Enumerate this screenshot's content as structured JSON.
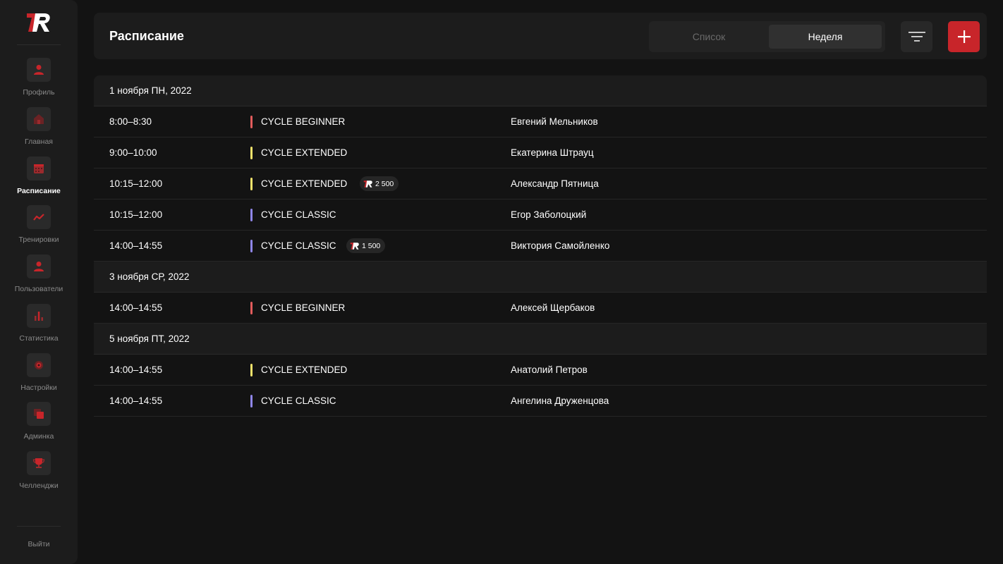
{
  "sidebar": {
    "items": [
      {
        "label": "Профиль",
        "icon": "user-icon"
      },
      {
        "label": "Главная",
        "icon": "home-icon"
      },
      {
        "label": "Расписание",
        "icon": "calendar-icon",
        "active": true
      },
      {
        "label": "Тренировки",
        "icon": "chart-line-icon"
      },
      {
        "label": "Пользователи",
        "icon": "users-icon"
      },
      {
        "label": "Статистика",
        "icon": "bar-chart-icon"
      },
      {
        "label": "Настройки",
        "icon": "gear-icon"
      },
      {
        "label": "Админка",
        "icon": "admin-icon"
      },
      {
        "label": "Челленджи",
        "icon": "trophy-icon"
      }
    ],
    "logout": "Выйти"
  },
  "header": {
    "title": "Расписание",
    "view_list": "Список",
    "view_week": "Неделя"
  },
  "schedule": {
    "days": [
      {
        "date": "1 ноября ПН, 2022",
        "rows": [
          {
            "time": "8:00–8:30",
            "name": "CYCLE BEGINNER",
            "color": "#e25c5c",
            "trainer": "Евгений Мельников",
            "badge": ""
          },
          {
            "time": "9:00–10:00",
            "name": "CYCLE EXTENDED",
            "color": "#f3e26b",
            "trainer": "Екатерина Штрауц",
            "badge": ""
          },
          {
            "time": "10:15–12:00",
            "name": "CYCLE EXTENDED",
            "color": "#f3e26b",
            "trainer": "Александр Пятница",
            "badge": "2 500"
          },
          {
            "time": "10:15–12:00",
            "name": "CYCLE CLASSIC",
            "color": "#8f86e8",
            "trainer": "Егор Заболоцкий",
            "badge": ""
          },
          {
            "time": "14:00–14:55",
            "name": "CYCLE CLASSIC",
            "color": "#8f86e8",
            "trainer": "Виктория Самойленко",
            "badge": "1 500"
          }
        ]
      },
      {
        "date": "3 ноября СР, 2022",
        "rows": [
          {
            "time": "14:00–14:55",
            "name": "CYCLE BEGINNER",
            "color": "#e25c5c",
            "trainer": "Алексей Щербаков",
            "badge": ""
          }
        ]
      },
      {
        "date": "5 ноября ПТ, 2022",
        "rows": [
          {
            "time": "14:00–14:55",
            "name": "CYCLE EXTENDED",
            "color": "#f3e26b",
            "trainer": "Анатолий Петров",
            "badge": ""
          },
          {
            "time": "14:00–14:55",
            "name": "CYCLE CLASSIC",
            "color": "#8f86e8",
            "trainer": "Ангелина Друженцова",
            "badge": ""
          }
        ]
      }
    ]
  },
  "colors": {
    "accent": "#c8252a",
    "background": "#131313",
    "panel": "#1c1c1c"
  }
}
